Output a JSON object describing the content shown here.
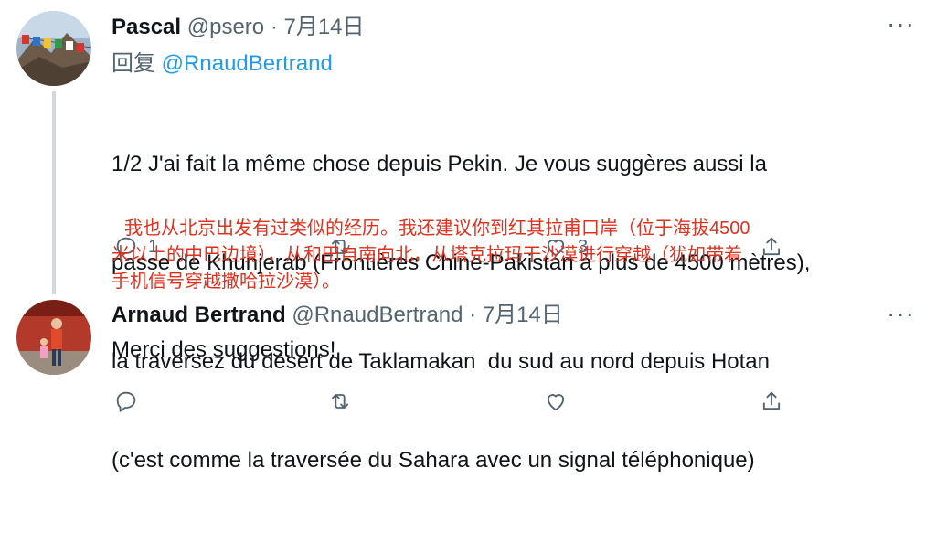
{
  "tweets": [
    {
      "name": "Pascal",
      "handle": "@psero",
      "sep": " · ",
      "date": "7月14日",
      "reply_label": "回复 ",
      "reply_mention": "@RnaudBertrand",
      "text_lines": [
        "1/2 J'ai fait la même chose depuis Pekin. Je vous suggères aussi la",
        "passe de Khunjerab (Frontières Chine-Pakistan à plus de 4500 mètres),",
        "la traversez du désert de Taklamakan  du sud au nord depuis Hotan",
        "(c'est comme la traversée du Sahara avec un signal téléphonique)"
      ],
      "translation_lines": [
        "我也从北京出发有过类似的经历。我还建议你到红其拉甫口岸（位于海拔4500",
        "米以上的中巴边境），从和田自南向北，从塔克拉玛干沙漠进行穿越（犹如带着",
        "手机信号穿越撒哈拉沙漠）。"
      ],
      "actions": {
        "reply_count": "1",
        "retweet_count": "",
        "like_count": "3"
      },
      "more_label": "···"
    },
    {
      "name": "Arnaud Bertrand",
      "handle": "@RnaudBertrand",
      "sep": " · ",
      "date": "7月14日",
      "text": "Merci des suggestions!",
      "actions": {
        "reply_count": "",
        "retweet_count": "",
        "like_count": ""
      },
      "more_label": "···"
    }
  ],
  "colors": {
    "accent": "#1d9bf0",
    "translation": "#e0301e",
    "muted": "#536471",
    "text": "#0f1419"
  },
  "icons": [
    "reply-icon",
    "retweet-icon",
    "like-icon",
    "share-icon",
    "more-icon"
  ]
}
